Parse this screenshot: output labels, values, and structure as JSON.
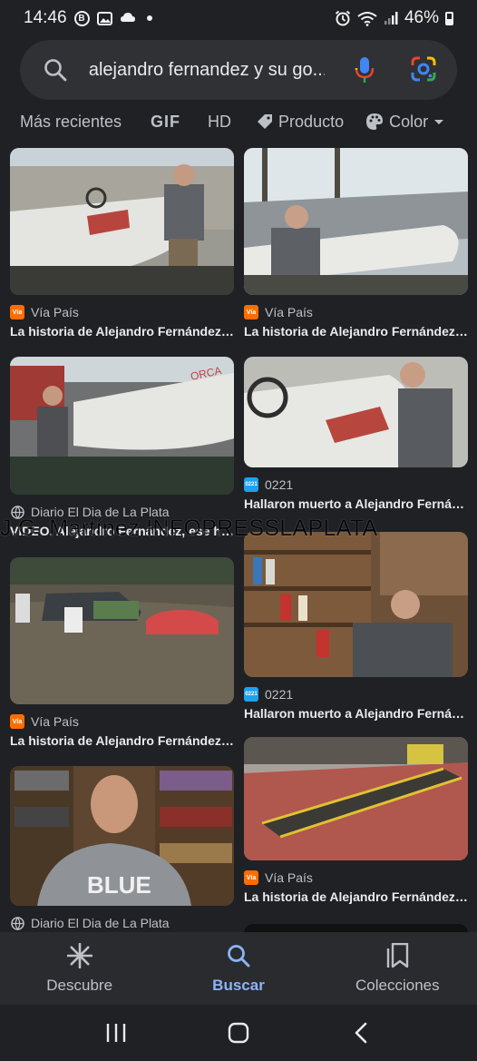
{
  "status_bar": {
    "time": "14:46",
    "battery": "46%",
    "icons": [
      "b-circle-icon",
      "image-icon",
      "weather-icon",
      "dot-icon",
      "alarm-icon",
      "wifi-icon",
      "signal-icon",
      "battery-icon"
    ]
  },
  "search": {
    "query": "alejandro fernandez y su go..."
  },
  "filters": {
    "recent": "Más recientes",
    "gif": "GIF",
    "hd": "HD",
    "product": "Producto",
    "color": "Color"
  },
  "results": [
    {
      "source": "Vía País",
      "title": "La historia de Alejandro Fernández,..."
    },
    {
      "source": "Vía País",
      "title": "La historia de Alejandro Fernández,..."
    },
    {
      "source": "Diario El Dia de La Plata",
      "title": "VIDEO. Alejandro Fernández, ese hé..."
    },
    {
      "source": "0221",
      "title": "Hallaron muerto a Alejandro Fernán..."
    },
    {
      "source": "0221",
      "title": "Hallaron muerto a Alejandro Fernán..."
    },
    {
      "source": "Vía País",
      "title": "La historia de Alejandro Fernández,..."
    },
    {
      "source": "Vía País",
      "title": "La historia de Alejandro Fernández,..."
    },
    {
      "source": "Diario El Dia de La Plata",
      "title": ""
    }
  ],
  "favicons": {
    "via": "Vía",
    "0221": "0221"
  },
  "watermark": "J.G. Martínez INFOPRESSLAPLATA",
  "thumb_text": {
    "boat": "ORCA",
    "shirt": "BLUE"
  },
  "bottom_nav": {
    "discover": "Descubre",
    "search": "Buscar",
    "collections": "Colecciones"
  },
  "colors": {
    "accent": "#8ab4f8",
    "background": "#202124",
    "search_bg": "#303134"
  }
}
